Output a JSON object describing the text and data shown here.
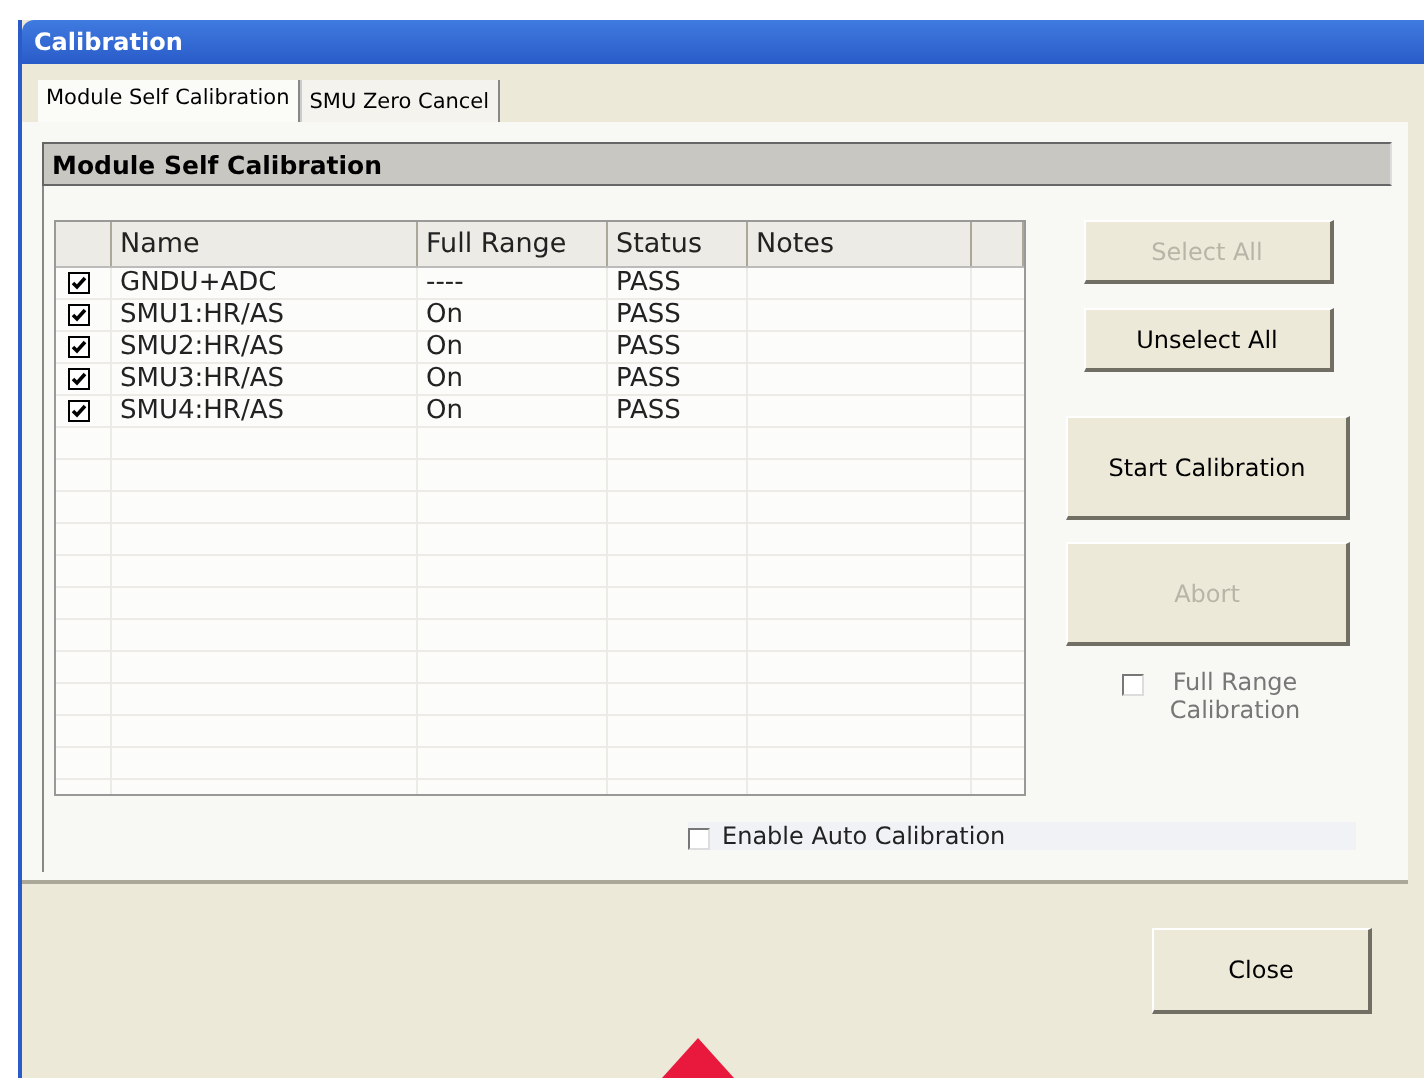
{
  "window": {
    "title": "Calibration"
  },
  "tabs": [
    {
      "label": "Module Self Calibration",
      "selected": true
    },
    {
      "label": "SMU Zero Cancel",
      "selected": false
    }
  ],
  "group": {
    "title": "Module Self Calibration"
  },
  "table": {
    "columns": [
      "Name",
      "Full Range",
      "Status",
      "Notes"
    ],
    "rows": [
      {
        "checked": true,
        "cells": [
          "GNDU+ADC",
          "----",
          "PASS",
          ""
        ]
      },
      {
        "checked": true,
        "cells": [
          "SMU1:HR/AS",
          "On",
          "PASS",
          ""
        ]
      },
      {
        "checked": true,
        "cells": [
          "SMU2:HR/AS",
          "On",
          "PASS",
          ""
        ]
      },
      {
        "checked": true,
        "cells": [
          "SMU3:HR/AS",
          "On",
          "PASS",
          ""
        ]
      },
      {
        "checked": true,
        "cells": [
          "SMU4:HR/AS",
          "On",
          "PASS",
          ""
        ]
      }
    ]
  },
  "side_buttons": [
    {
      "label": "Select All",
      "disabled": true,
      "kind": "short"
    },
    {
      "label": "Unselect All",
      "disabled": false,
      "kind": "short"
    },
    {
      "label": "Start Calibration",
      "disabled": false,
      "kind": "tall"
    },
    {
      "label": "Abort",
      "disabled": true,
      "kind": "tall"
    }
  ],
  "full_range_option": {
    "label": "Full Range Calibration",
    "checked": false,
    "disabled": true
  },
  "auto_calibration": {
    "label": "Enable Auto Calibration",
    "checked": false
  },
  "buttons": [
    {
      "label": "Close"
    }
  ]
}
